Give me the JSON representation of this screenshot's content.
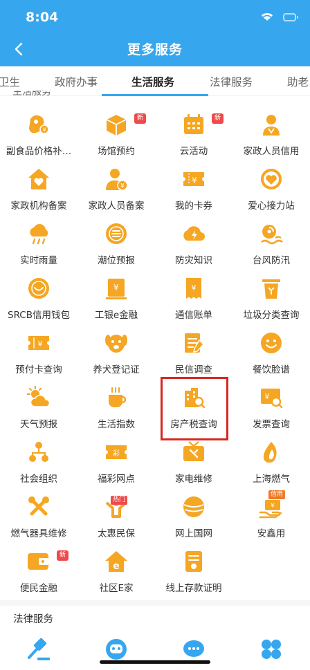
{
  "status_bar": {
    "time": "8:04"
  },
  "header": {
    "title": "更多服务"
  },
  "tabs": [
    {
      "label": "卫生"
    },
    {
      "label": "政府办事"
    },
    {
      "label": "生活服务"
    },
    {
      "label": "法律服务"
    },
    {
      "label": "助老"
    }
  ],
  "partial_section": {
    "title": "生活服务"
  },
  "services": [
    {
      "label": "副食品价格补…",
      "icon": "price-subsidy-icon"
    },
    {
      "label": "场馆预约",
      "icon": "venue-booking-icon",
      "badge": "新"
    },
    {
      "label": "云活动",
      "icon": "cloud-activity-icon",
      "badge": "新"
    },
    {
      "label": "家政人员信用",
      "icon": "housekeeper-credit-icon"
    },
    {
      "label": "家政机构备案",
      "icon": "agency-registration-icon"
    },
    {
      "label": "家政人员备案",
      "icon": "staff-registration-icon"
    },
    {
      "label": "我的卡券",
      "icon": "coupon-icon"
    },
    {
      "label": "爱心接力站",
      "icon": "love-relay-icon"
    },
    {
      "label": "实时雨量",
      "icon": "rainfall-icon"
    },
    {
      "label": "潮位预报",
      "icon": "tide-forecast-icon"
    },
    {
      "label": "防灾知识",
      "icon": "disaster-knowledge-icon"
    },
    {
      "label": "台风防汛",
      "icon": "typhoon-icon"
    },
    {
      "label": "SRCB信用钱包",
      "icon": "credit-wallet-icon"
    },
    {
      "label": "工银e金融",
      "icon": "icbc-finance-icon"
    },
    {
      "label": "通信账单",
      "icon": "telecom-bill-icon"
    },
    {
      "label": "垃圾分类查询",
      "icon": "garbage-sorting-icon"
    },
    {
      "label": "预付卡查询",
      "icon": "prepaid-card-icon"
    },
    {
      "label": "养犬登记证",
      "icon": "dog-registration-icon"
    },
    {
      "label": "民信调查",
      "icon": "survey-icon"
    },
    {
      "label": "餐饮脸谱",
      "icon": "restaurant-face-icon"
    },
    {
      "label": "天气预报",
      "icon": "weather-icon"
    },
    {
      "label": "生活指数",
      "icon": "life-index-icon"
    },
    {
      "label": "房产税查询",
      "icon": "property-tax-icon"
    },
    {
      "label": "发票查询",
      "icon": "invoice-icon"
    },
    {
      "label": "社会组织",
      "icon": "social-org-icon"
    },
    {
      "label": "福彩网点",
      "icon": "lottery-icon"
    },
    {
      "label": "家电维修",
      "icon": "appliance-repair-icon"
    },
    {
      "label": "上海燃气",
      "icon": "gas-icon"
    },
    {
      "label": "燃气器具维修",
      "icon": "gas-repair-icon"
    },
    {
      "label": "太惠民保",
      "icon": "insurance-icon",
      "tag": "热门"
    },
    {
      "label": "网上国网",
      "icon": "state-grid-icon"
    },
    {
      "label": "安鑫用",
      "icon": "anxin-icon",
      "tag": "信用"
    },
    {
      "label": "便民金融",
      "icon": "convenience-finance-icon",
      "badge": "新"
    },
    {
      "label": "社区E家",
      "icon": "community-home-icon"
    },
    {
      "label": "线上存款证明",
      "icon": "deposit-proof-icon"
    }
  ],
  "law_section": {
    "title": "法律服务",
    "icons": [
      "gavel-icon",
      "robot-icon",
      "chat-icon",
      "clover-icon"
    ]
  },
  "colors": {
    "header_bg": "#36a7ee",
    "icon_orange": "#f5a623",
    "badge_red": "#ef4a4a",
    "highlight_red": "#d7261e"
  }
}
